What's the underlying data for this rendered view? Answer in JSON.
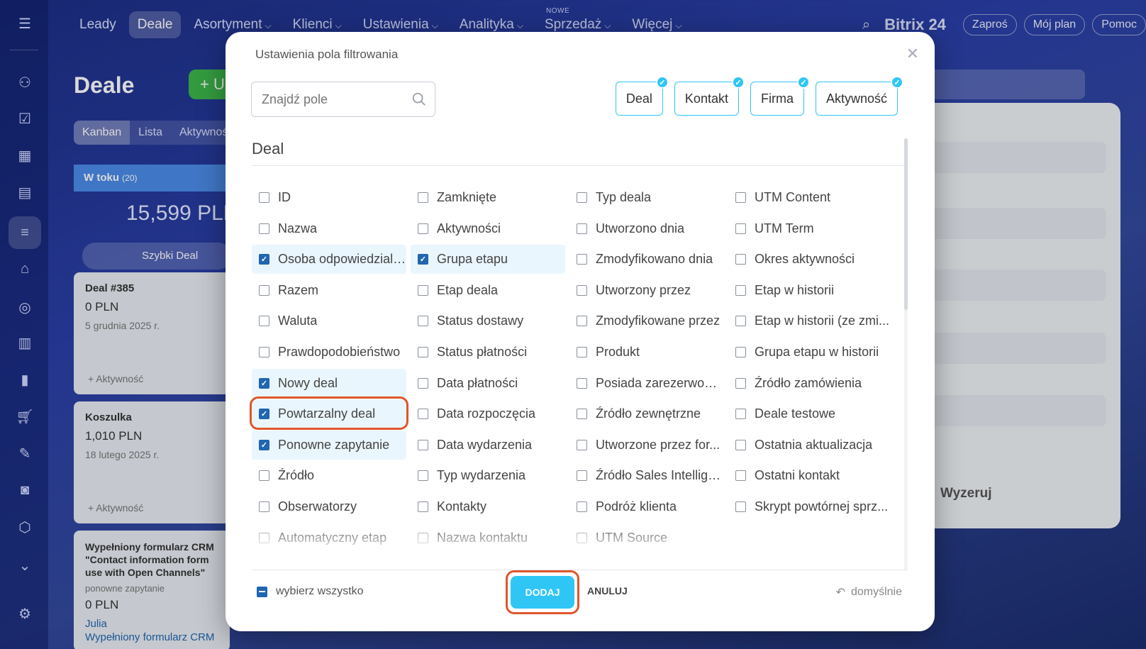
{
  "topnav": {
    "items": [
      {
        "label": "Leady",
        "has_menu": false,
        "active": false
      },
      {
        "label": "Deale",
        "has_menu": false,
        "active": true
      },
      {
        "label": "Asortyment",
        "has_menu": true,
        "active": false
      },
      {
        "label": "Klienci",
        "has_menu": true,
        "active": false
      },
      {
        "label": "Ustawienia",
        "has_menu": true,
        "active": false
      },
      {
        "label": "Analityka",
        "has_menu": true,
        "active": false
      },
      {
        "label": "Sprzedaż",
        "has_menu": true,
        "active": false,
        "badge": "NOWE"
      },
      {
        "label": "Więcej",
        "has_menu": true,
        "active": false
      }
    ],
    "logo": "Bitrix 24",
    "invite_label": "Zaproś",
    "plan_label": "Mój plan",
    "help_label": "Pomoc"
  },
  "page": {
    "title": "Deale",
    "add_label": "+ U",
    "view_tabs": [
      "Kanban",
      "Lista",
      "Aktywnoś"
    ],
    "column": {
      "title": "W toku",
      "count": "(20)",
      "sum": "15,599 PLN",
      "quick_deal": "Szybki Deal"
    },
    "cards": [
      {
        "title": "Deal #385",
        "value": "0 PLN",
        "date": "5 grudnia 2025 r.",
        "activity": "+ Aktywność"
      },
      {
        "title": "Koszulka",
        "value": "1,010 PLN",
        "date": "18 lutego 2025 r.",
        "activity": "+ Aktywność"
      },
      {
        "title": "Wypełniony formularz CRM \"Contact information form use with Open Channels\"",
        "subtitle": "ponowne zapytanie",
        "value": "0 PLN",
        "person": "Julia",
        "extra": "Wypełniony formularz CRM"
      }
    ],
    "right_panel_reset": "Wyzeruj"
  },
  "modal": {
    "title": "Ustawienia pola filtrowania",
    "search_placeholder": "Znajdź pole",
    "chips": [
      "Deal",
      "Kontakt",
      "Firma",
      "Aktywność"
    ],
    "section_title": "Deal",
    "columns": [
      [
        {
          "label": "ID",
          "checked": false
        },
        {
          "label": "Nazwa",
          "checked": false
        },
        {
          "label": "Osoba odpowiedzialna",
          "checked": true
        },
        {
          "label": "Razem",
          "checked": false
        },
        {
          "label": "Waluta",
          "checked": false
        },
        {
          "label": "Prawdopodobieństwo",
          "checked": false
        },
        {
          "label": "Nowy deal",
          "checked": true
        },
        {
          "label": "Powtarzalny deal",
          "checked": true,
          "highlighted": true
        },
        {
          "label": "Ponowne zapytanie",
          "checked": true
        },
        {
          "label": "Źródło",
          "checked": false
        },
        {
          "label": "Obserwatorzy",
          "checked": false
        },
        {
          "label": "Automatyczny etap",
          "checked": false
        }
      ],
      [
        {
          "label": "Zamknięte",
          "checked": false
        },
        {
          "label": "Aktywności",
          "checked": false
        },
        {
          "label": "Grupa etapu",
          "checked": true
        },
        {
          "label": "Etap deala",
          "checked": false
        },
        {
          "label": "Status dostawy",
          "checked": false
        },
        {
          "label": "Status płatności",
          "checked": false
        },
        {
          "label": "Data płatności",
          "checked": false
        },
        {
          "label": "Data rozpoczęcia",
          "checked": false
        },
        {
          "label": "Data wydarzenia",
          "checked": false
        },
        {
          "label": "Typ wydarzenia",
          "checked": false
        },
        {
          "label": "Kontakty",
          "checked": false
        },
        {
          "label": "Nazwa kontaktu",
          "checked": false
        }
      ],
      [
        {
          "label": "Typ deala",
          "checked": false
        },
        {
          "label": "Utworzono dnia",
          "checked": false
        },
        {
          "label": "Zmodyfikowano dnia",
          "checked": false
        },
        {
          "label": "Utworzony przez",
          "checked": false
        },
        {
          "label": "Zmodyfikowane przez",
          "checked": false
        },
        {
          "label": "Produkt",
          "checked": false
        },
        {
          "label": "Posiada zarezerwowa...",
          "checked": false
        },
        {
          "label": "Źródło zewnętrzne",
          "checked": false
        },
        {
          "label": "Utworzone przez for...",
          "checked": false
        },
        {
          "label": "Źródło Sales Intellige...",
          "checked": false
        },
        {
          "label": "Podróż klienta",
          "checked": false
        },
        {
          "label": "UTM Source",
          "checked": false
        }
      ],
      [
        {
          "label": "UTM Content",
          "checked": false
        },
        {
          "label": "UTM Term",
          "checked": false
        },
        {
          "label": "Okres aktywności",
          "checked": false
        },
        {
          "label": "Etap w historii",
          "checked": false
        },
        {
          "label": "Etap w historii (ze zmi...",
          "checked": false
        },
        {
          "label": "Grupa etapu w historii",
          "checked": false
        },
        {
          "label": "Źródło zamówienia",
          "checked": false
        },
        {
          "label": "Deale testowe",
          "checked": false
        },
        {
          "label": "Ostatnia aktualizacja",
          "checked": false
        },
        {
          "label": "Ostatni kontakt",
          "checked": false
        },
        {
          "label": "Skrypt powtórnej sprz...",
          "checked": false
        }
      ]
    ],
    "select_all_label": "wybierz wszystko",
    "add_label": "DODAJ",
    "cancel_label": "ANULUJ",
    "default_label": "domyślnie"
  },
  "colors": {
    "accent": "#2fc6f6",
    "checkbox": "#2066b0",
    "highlight": "#e0562b",
    "add_green": "#3cb54a"
  }
}
